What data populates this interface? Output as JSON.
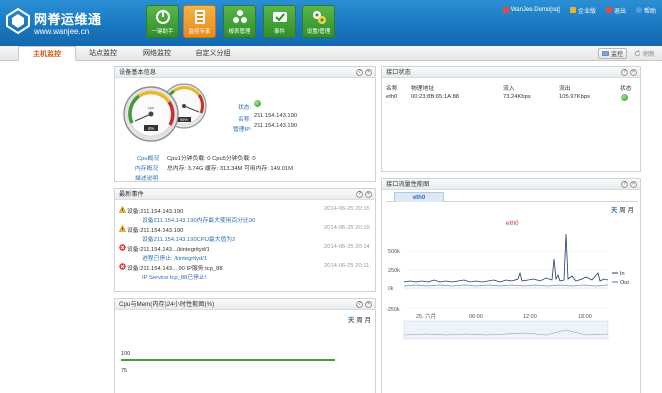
{
  "app": {
    "title": "网脊运维通",
    "url": "www.wanjee.cn"
  },
  "nav": [
    {
      "label": "一键助手",
      "icon": "power-icon",
      "active": false
    },
    {
      "label": "监控专家",
      "icon": "monitor-icon",
      "active": true
    },
    {
      "label": "报表管理",
      "icon": "report-icon",
      "active": false
    },
    {
      "label": "事件",
      "icon": "event-icon",
      "active": false
    },
    {
      "label": "设置/管理",
      "icon": "settings-icon",
      "active": false
    }
  ],
  "user_bar": {
    "user": "WanJee.Demo[sq]",
    "enterprise": "企业版",
    "logout": "退出",
    "help": "帮助"
  },
  "tabs": [
    "主机监控",
    "站点监控",
    "网络监控",
    "自定义分组"
  ],
  "tab_tools": {
    "monitor": "监控",
    "refresh": "刷新"
  },
  "device_info": {
    "title": "设备基本信息",
    "status_label": "状态:",
    "name_label": "名称:",
    "name_value": "211.154.143.190",
    "mgmt_label": "管理IP:",
    "mgmt_value": "211.154.143.190",
    "cpu_label": "Cpu概况",
    "mem_label": "内存概况",
    "desc_label": "描述说明",
    "cpu_load": "Cpu1分钟负载: 0  Cpu5分钟负载: 0",
    "mem_stats": "总内存: 3.74G  缓存: 313.34M  可用内存: 149.01M",
    "gauge_cpu_text": "cpu",
    "gauge_cpu_value": "4%",
    "gauge_mem_value": "96%"
  },
  "events": {
    "title": "最新事件",
    "items": [
      {
        "level": "warn",
        "device": "设备:211.154.143.190",
        "time": "2014-06-25 20:15",
        "detail": "设备211.154.143.190内存最大使用百分比90"
      },
      {
        "level": "warn",
        "device": "设备:211.154.143.190",
        "time": "2014-06-25 20:15",
        "detail": "设备211.154.143.190CPU最大值为2"
      },
      {
        "level": "error",
        "device": "设备:211.154.143.../kintegrityd/1",
        "time": "2014-06-25 20:14",
        "detail": "进程已停止: /kintegrityd/1"
      },
      {
        "level": "error",
        "device": "设备:211.154.143....90 IP服务:tcp_88",
        "time": "2014-06-25 20:11",
        "detail": "IP Service tcp_88已停止!"
      }
    ]
  },
  "cpu_mem": {
    "title": "Cpu与Mem(内存)24小时性能图(%)",
    "range_day": "天",
    "range_week": "周",
    "range_month": "月",
    "y_100": "100",
    "y_75": "75"
  },
  "interfaces": {
    "title": "接口状态",
    "headers": [
      "名称",
      "物理地址",
      "流入",
      "流出",
      "状态"
    ],
    "rows": [
      {
        "name": "eth0",
        "mac": "00:23:8B:65:1A:88",
        "in": "73.24Kbps",
        "out": "105.97Kbps"
      }
    ]
  },
  "traffic": {
    "title": "接口流量性能图",
    "tab": "eth0",
    "series_title": "eth0",
    "range_day": "天",
    "range_week": "周",
    "range_month": "月",
    "y_ticks": [
      "500k",
      "250k",
      "0k",
      "-250k"
    ],
    "legend_in": "In",
    "legend_out": "Out",
    "x_labels": [
      "25. 六月",
      "06:00",
      "12:00",
      "18:00"
    ]
  },
  "colors": {
    "header": "#1876bf",
    "active_tab": "#d05e16",
    "status_ok": "#3fb43a",
    "link": "#2f6fb3"
  }
}
